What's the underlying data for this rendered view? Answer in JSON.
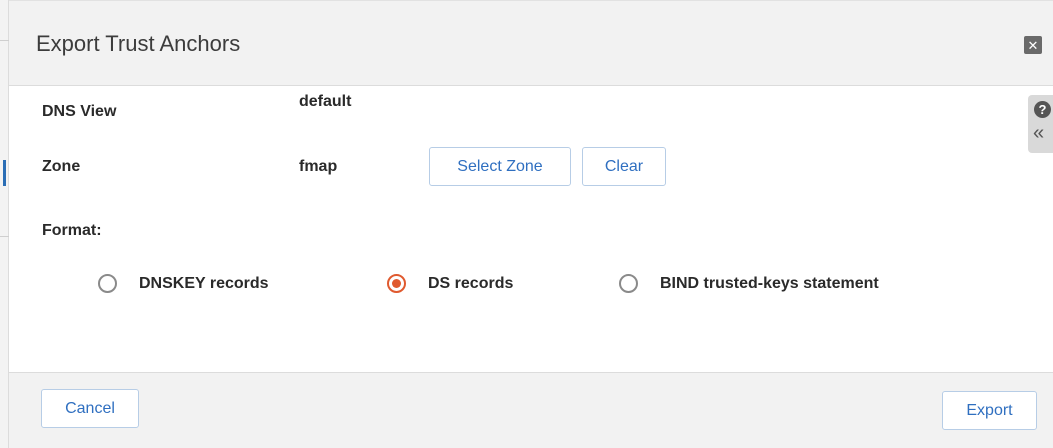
{
  "dialog": {
    "title": "Export Trust Anchors",
    "close_icon": "close-icon"
  },
  "help": {
    "help_glyph": "?",
    "collapse_glyph": "«"
  },
  "fields": {
    "dns_view_label": "DNS View",
    "dns_view_value": "default",
    "zone_label": "Zone",
    "zone_value": "fmap",
    "select_zone_label": "Select Zone",
    "clear_label": "Clear",
    "format_label": "Format:"
  },
  "format_options": [
    {
      "label": "DNSKEY records",
      "selected": false
    },
    {
      "label": "DS records",
      "selected": true
    },
    {
      "label": "BIND trusted-keys statement",
      "selected": false
    }
  ],
  "footer": {
    "cancel_label": "Cancel",
    "export_label": "Export"
  },
  "colors": {
    "accent_radio": "#e05a2f",
    "button_text": "#2f6fc0",
    "header_bg": "#f2f2f2"
  }
}
